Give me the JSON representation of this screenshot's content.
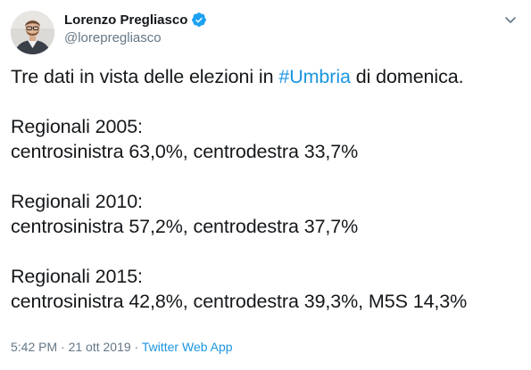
{
  "author": {
    "display_name": "Lorenzo Pregliasco",
    "handle": "@lorepregliasco",
    "verified": true
  },
  "tweet": {
    "intro_before": "Tre dati in vista delle elezioni in ",
    "hashtag": "#Umbria",
    "intro_after": " di domenica.",
    "blocks": [
      {
        "heading": "Regionali 2005:",
        "results": "centrosinistra 63,0%, centrodestra 33,7%"
      },
      {
        "heading": "Regionali 2010:",
        "results": "centrosinistra 57,2%, centrodestra 37,7%"
      },
      {
        "heading": "Regionali 2015:",
        "results": "centrosinistra 42,8%, centrodestra 39,3%, M5S 14,3%"
      }
    ]
  },
  "meta": {
    "time": "5:42 PM",
    "separator": " · ",
    "date": "21 ott 2019",
    "source": "Twitter Web App"
  },
  "colors": {
    "link": "#1b95e0",
    "secondary_text": "#657786",
    "primary_text": "#14171a",
    "verified_badge": "#1da1f2"
  },
  "icons": {
    "verified": "verified-badge-icon",
    "menu": "chevron-down-icon"
  }
}
